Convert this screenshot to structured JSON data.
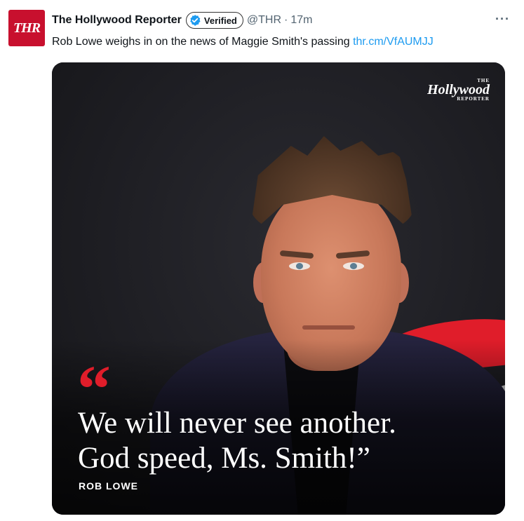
{
  "account": {
    "avatar_text": "THR",
    "name": "The Hollywood Reporter",
    "verified_label": "Verified",
    "handle": "@THR",
    "separator": "·",
    "time": "17m",
    "more_label": "···"
  },
  "tweet": {
    "text": "Rob Lowe weighs in on the news of Maggie Smith's passing",
    "link": "thr.cm/VfAUMJJ"
  },
  "media": {
    "brand_logo": "Hollywood",
    "brand_small": "THE",
    "brand_sub": "REPORTER",
    "quote_mark": "“",
    "quote_line1": "We will never see another.",
    "quote_line2": "God speed, Ms. Smith!”",
    "attribution": "ROB LOWE"
  },
  "colors": {
    "accent": "#1d9bf0",
    "brand_red": "#e01d2a",
    "verified_badge": "#1d9bf0"
  }
}
